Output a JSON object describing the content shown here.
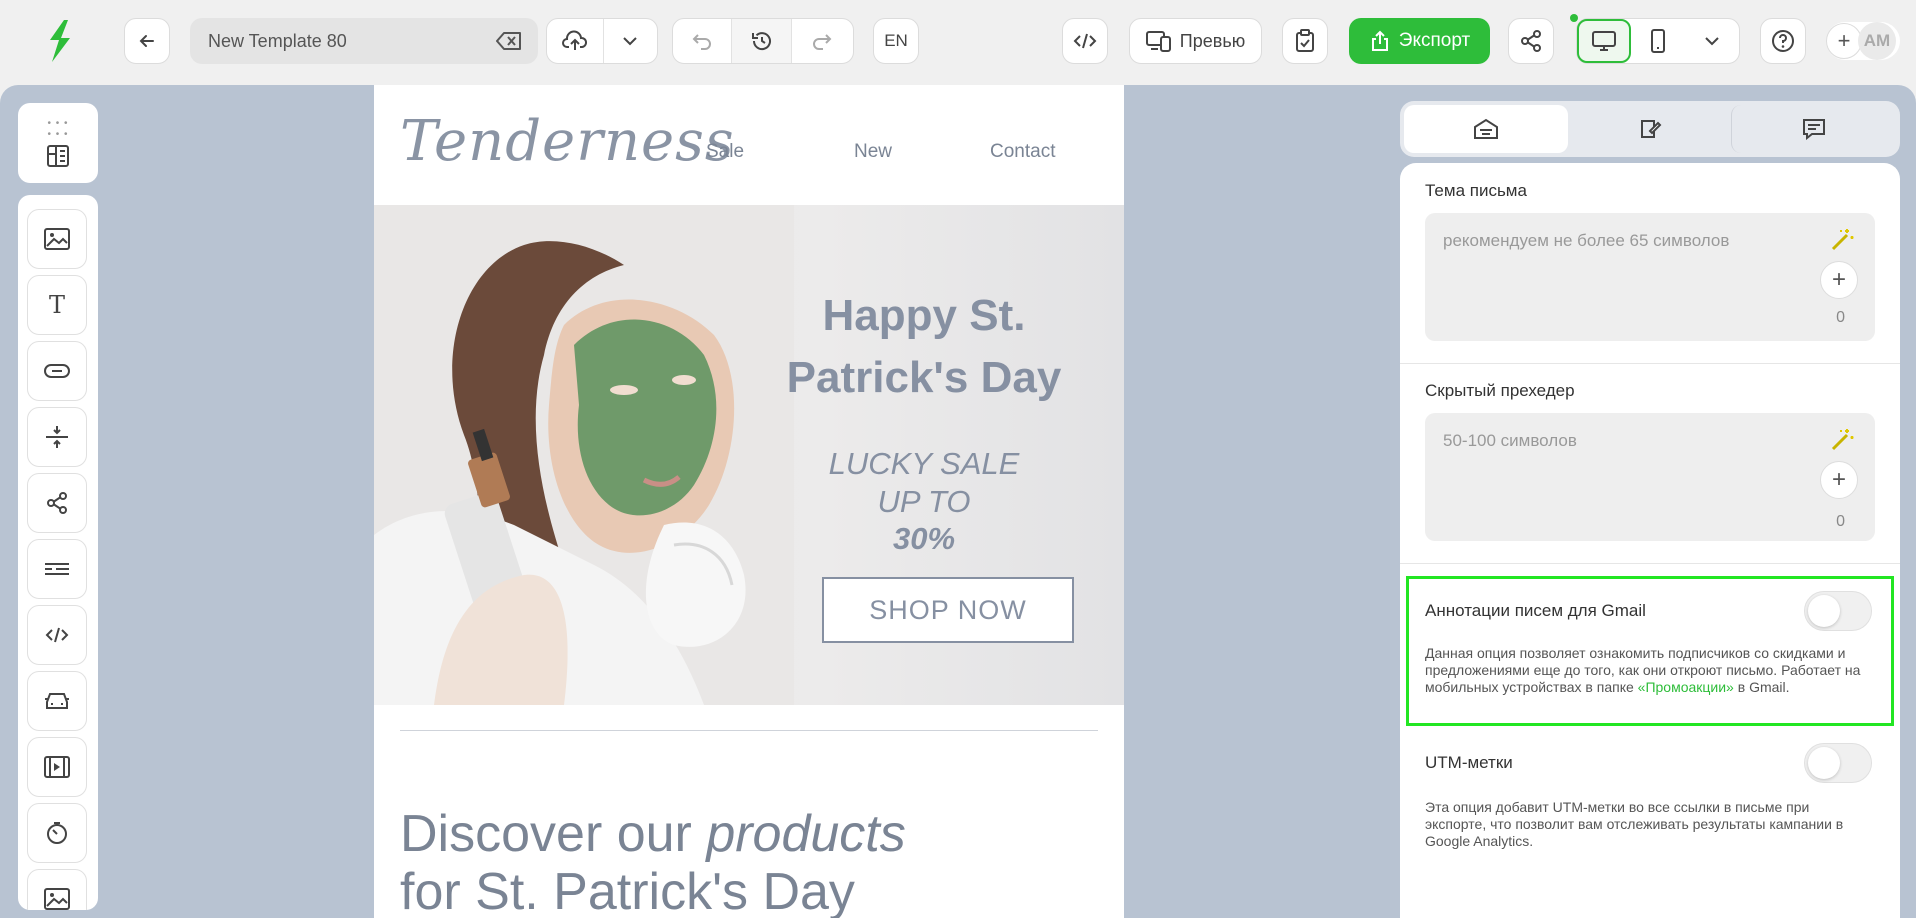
{
  "toolbar": {
    "template_name": "New Template 80",
    "language": "EN",
    "preview_label": "Превью",
    "export_label": "Экспорт",
    "avatar_initials": "AM"
  },
  "email": {
    "brand": "Tenderness",
    "nav": [
      "Sale",
      "New",
      "Contact"
    ],
    "hero_title_line1": "Happy St.",
    "hero_title_line2": "Patrick's Day",
    "hero_sub_line1": "LUCKY SALE",
    "hero_sub_line2": "UP TO",
    "hero_percent": "30%",
    "shop_button": "SHOP NOW",
    "discover_plain": "Discover our ",
    "discover_em": "products",
    "discover_line2": "for St. Patrick's Day"
  },
  "panel": {
    "subject": {
      "label": "Тема письма",
      "placeholder": "рекомендуем не более 65 символов",
      "count": "0"
    },
    "preheader": {
      "label": "Скрытый прехедер",
      "placeholder": "50-100 символов",
      "count": "0"
    },
    "gmail": {
      "label": "Аннотации писем для Gmail",
      "desc_before": "Данная опция позволяет ознакомить подписчиков со скидками и предложениями еще до того, как они откроют письмо. Работает на мобильных устройствах в папке ",
      "desc_link": "«Промоакции»",
      "desc_after": " в Gmail.",
      "enabled": false
    },
    "utm": {
      "label": "UTM-метки",
      "desc": "Эта опция добавит UTM-метки во все ссылки в письме при экспорте, что позволит вам отслеживать результаты кампании в Google Analytics.",
      "enabled": false
    }
  },
  "colors": {
    "accent_green": "#2ebd3a",
    "highlight_green": "#22e622",
    "workspace_bg": "#b8c3d2",
    "email_text": "#8690a2"
  }
}
